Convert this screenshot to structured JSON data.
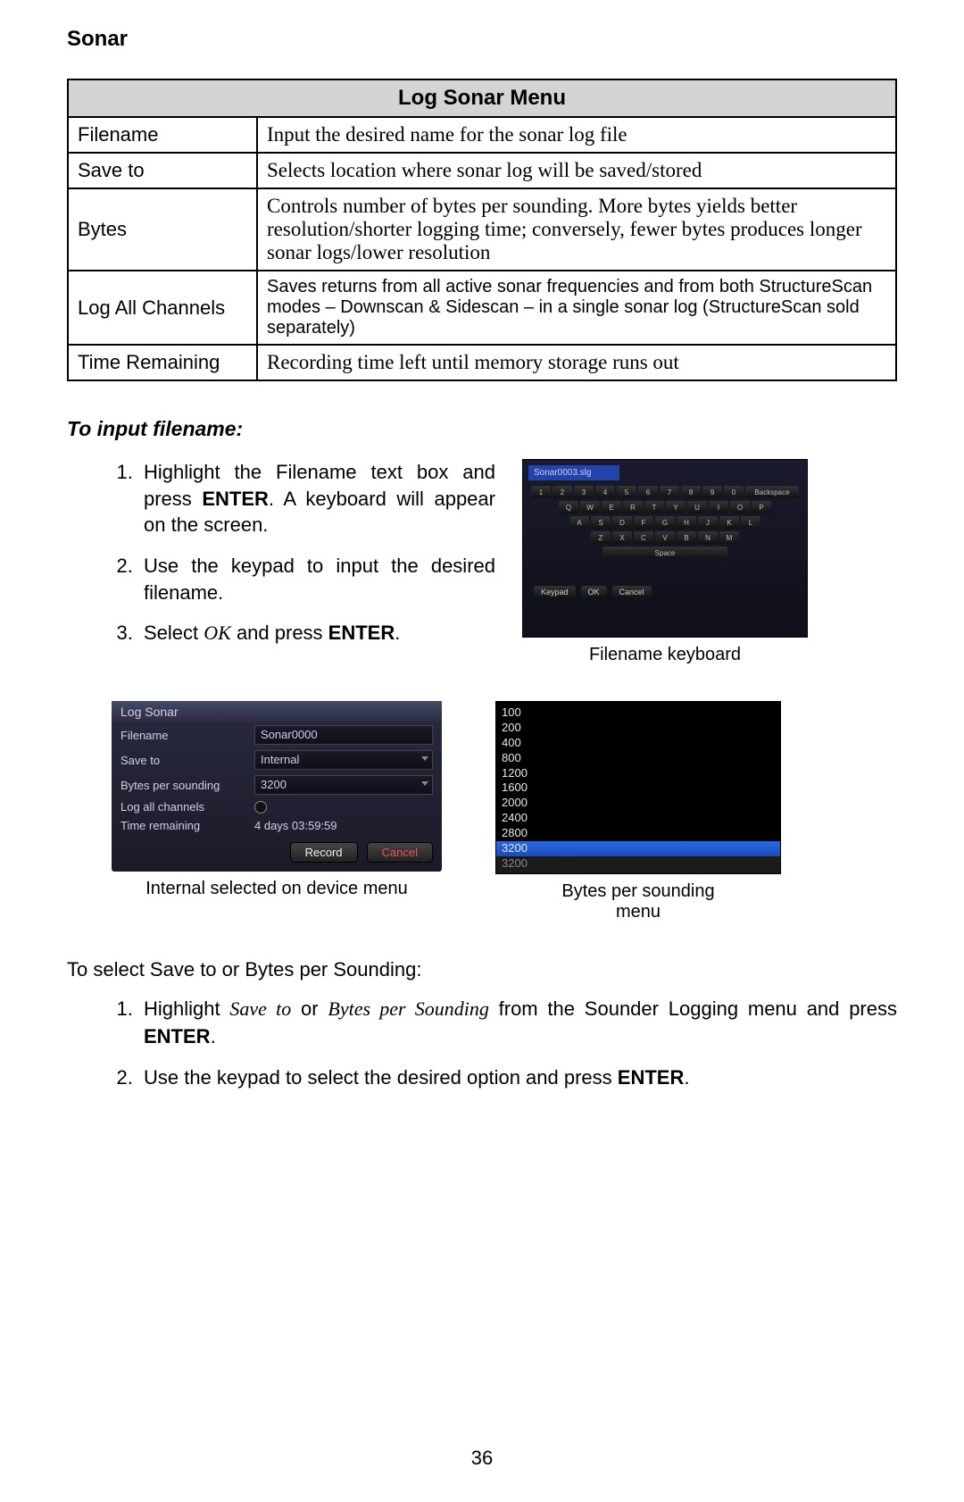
{
  "heading": "Sonar",
  "table": {
    "header": "Log Sonar Menu",
    "rows": [
      {
        "name": "Filename",
        "desc": "Input the desired name for the sonar log file"
      },
      {
        "name": "Save to",
        "desc": "Selects location where sonar log will be saved/stored"
      },
      {
        "name": "Bytes",
        "desc": "Controls number of bytes per sounding. More bytes yields better resolution/shorter logging time; conversely, fewer bytes produces longer sonar logs/lower resolution"
      },
      {
        "name": "Log All Channels",
        "desc": "Saves returns from all active sonar frequencies and from both StructureScan modes – Downscan & Sidescan – in a single sonar log (StructureScan sold separately)"
      },
      {
        "name": "Time Remaining",
        "desc": "Recording time left until memory storage runs out"
      }
    ]
  },
  "subhead": "To input filename:",
  "steps1": {
    "s1a": "Highlight the Filename text box and press ",
    "s1b": "ENTER",
    "s1c": ". A keyboard will appear on the screen.",
    "s2": "Use the keypad to input the desired filename.",
    "s3a": "Select ",
    "s3b": "OK",
    "s3c": " and press ",
    "s3d": "ENTER",
    "s3e": "."
  },
  "kb": {
    "field": "Sonar0003.slg",
    "row1": [
      "1",
      "2",
      "3",
      "4",
      "5",
      "6",
      "7",
      "8",
      "9",
      "0",
      "Backspace"
    ],
    "row2": [
      "Q",
      "W",
      "E",
      "R",
      "T",
      "Y",
      "U",
      "I",
      "O",
      "P"
    ],
    "row3": [
      "A",
      "S",
      "D",
      "F",
      "G",
      "H",
      "J",
      "K",
      "L"
    ],
    "row4": [
      "Z",
      "X",
      "C",
      "V",
      "B",
      "N",
      "M"
    ],
    "space": "Space",
    "bottom": [
      "Keypad",
      "OK",
      "Cancel"
    ],
    "caption": "Filename keyboard"
  },
  "dlg": {
    "title": "Log Sonar",
    "filename_lab": "Filename",
    "filename_val": "Sonar0000",
    "saveto_lab": "Save to",
    "saveto_val": "Internal",
    "bps_lab": "Bytes per sounding",
    "bps_val": "3200",
    "logall_lab": "Log all channels",
    "time_lab": "Time remaining",
    "time_val": "4 days 03:59:59",
    "record": "Record",
    "cancel": "Cancel",
    "caption": "Internal selected on device menu"
  },
  "bytes": {
    "items": [
      "100",
      "200",
      "400",
      "800",
      "1200",
      "1600",
      "2000",
      "2400",
      "2800",
      "3200",
      "3200"
    ],
    "selected_index": 9,
    "caption1": "Bytes per sounding",
    "caption2": "menu"
  },
  "plain": "To select Save to or Bytes per Sounding:",
  "steps2": {
    "s1a": "Highlight ",
    "s1b": "Save to",
    "s1c": " or ",
    "s1d": "Bytes per Sounding",
    "s1e": " from the Sounder Logging menu and press ",
    "s1f": "ENTER",
    "s1g": ".",
    "s2a": "Use the keypad to select the desired option and press ",
    "s2b": "ENTER",
    "s2c": "."
  },
  "pagenum": "36"
}
